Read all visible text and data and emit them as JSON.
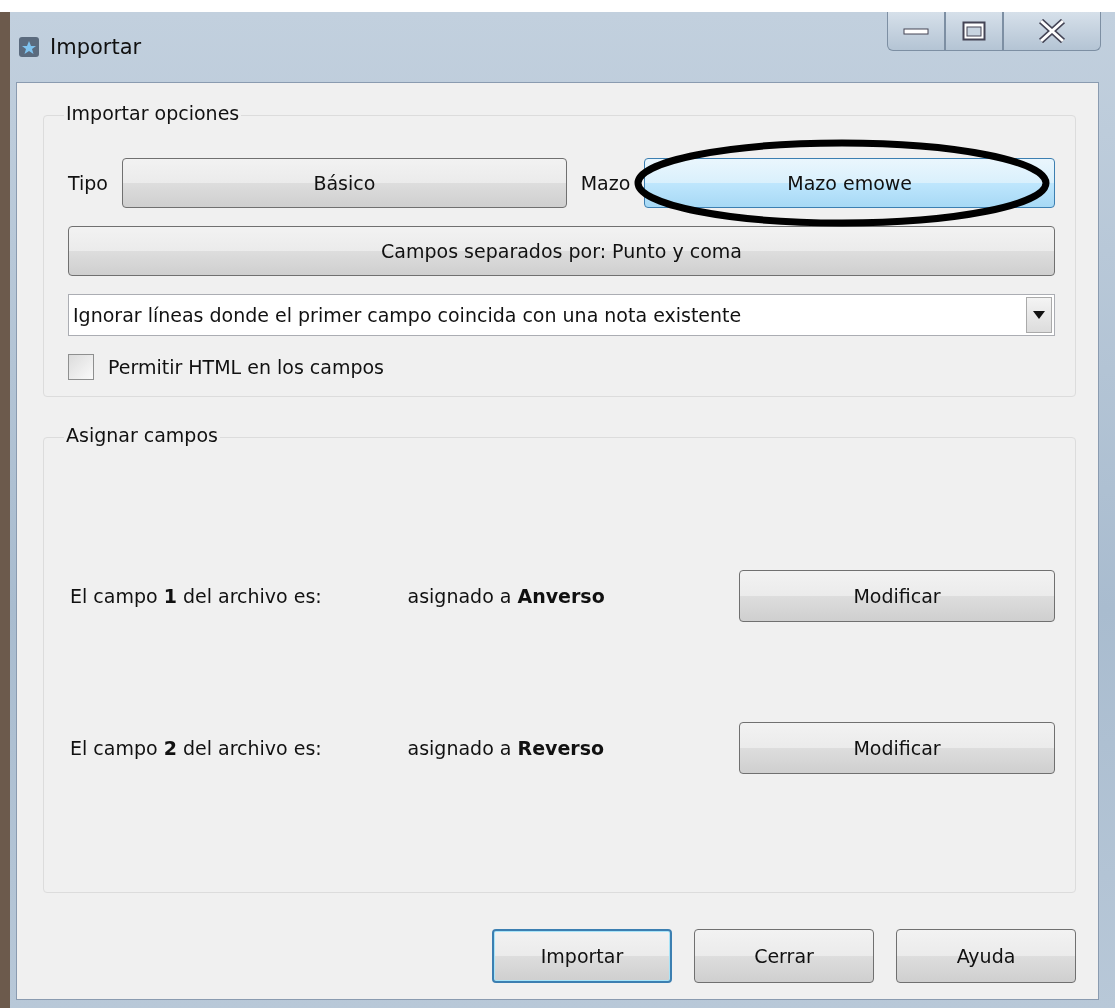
{
  "window": {
    "title": "Importar"
  },
  "import_options": {
    "title": "Importar opciones",
    "type_label": "Tipo",
    "type_button": {
      "label": "Básico",
      "highlighted": false
    },
    "deck_label": "Mazo",
    "deck_button": {
      "label": "Mazo emowe",
      "highlighted": true,
      "circled": true
    },
    "separator_button": {
      "label": "Campos separados por: Punto y coma"
    },
    "duplicate_mode": {
      "value": "Ignorar líneas donde el primer campo coincida con una nota existente"
    },
    "allow_html": {
      "label": "Permitir HTML en los campos",
      "checked": false
    }
  },
  "field_mapping": {
    "title": "Asignar campos",
    "rows": [
      {
        "source": "El campo **1** del archivo es:",
        "target": "asignado a **Anverso**",
        "button": "Modificar"
      },
      {
        "source": "El campo **2** del archivo es:",
        "target": "asignado a **Reverso**",
        "button": "Modificar"
      }
    ]
  },
  "buttons": [
    {
      "label": "Importar",
      "default": true
    },
    {
      "label": "Cerrar",
      "default": false
    },
    {
      "label": "Ayuda",
      "default": false
    }
  ]
}
